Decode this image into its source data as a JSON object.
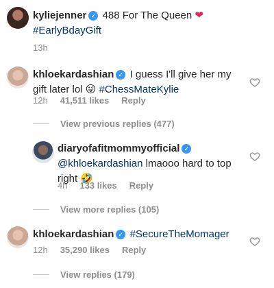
{
  "post": {
    "username": "kyliejenner",
    "text": "488 For The Queen",
    "emoji": "❤",
    "hashtag": "#EarlyBdayGift",
    "time": "13h"
  },
  "comment1": {
    "username": "khloekardashian",
    "text": "I guess I'll give her my gift later lol",
    "emoji": "😜",
    "hashtag": "#ChessMateKylie",
    "time": "12h",
    "likes": "41,511 likes",
    "reply": "Reply",
    "view_previous": "View previous replies (477)"
  },
  "reply1": {
    "username": "diaryofafitmommyofficial",
    "mention": "@khloekardashian",
    "text": "lmaooo hard to top right",
    "emoji": "🤣",
    "time": "4h",
    "likes": "133 likes",
    "reply": "Reply",
    "view_more": "View more replies (105)"
  },
  "comment2": {
    "username": "khloekardashian",
    "hashtag": "#SecureTheMomager",
    "time": "12h",
    "likes": "35,290 likes",
    "reply": "Reply",
    "view_replies": "View replies (179)"
  },
  "icons": {
    "verified": "verified-badge-icon",
    "like": "heart-outline-icon"
  },
  "colors": {
    "hashtag": "#003569",
    "verified": "#3897f0",
    "meta": "#8e8e8e"
  }
}
